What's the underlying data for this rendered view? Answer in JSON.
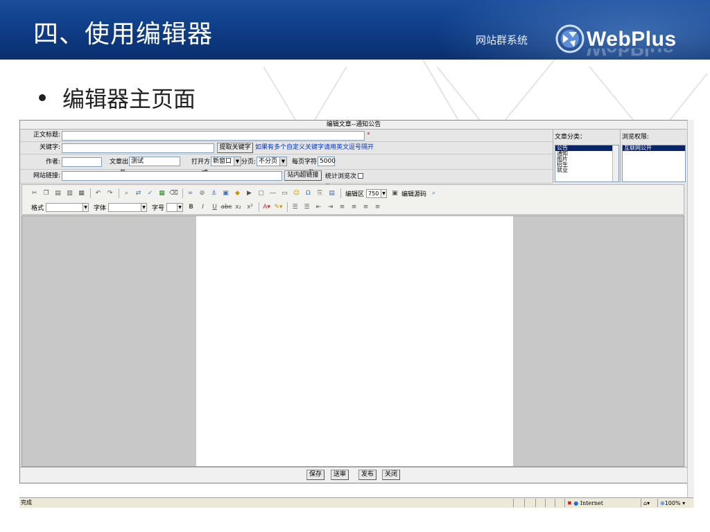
{
  "slide": {
    "title": "四、使用编辑器",
    "brand_sub": "网站群系统",
    "brand_name": "WebPlus",
    "bullet": "编辑器主页面"
  },
  "window": {
    "title": "编辑文章--通知公告"
  },
  "form": {
    "title_label": "正文标题:",
    "required_mark": "*",
    "keyword_label": "关键字:",
    "keyword_button": "提取关键字",
    "keyword_hint": "如果有多个自定义关键字请用英文逗号隔开",
    "author_label": "作者:",
    "source_label": "文章出处:",
    "source_value": "测试",
    "open_mode_label": "打开方式:",
    "open_mode_value": "新窗口",
    "paging_label": "分页:",
    "paging_value": "不分页",
    "chars_label": "每页字符数:",
    "chars_value": "5000",
    "link_label": "网站链接:",
    "site_link_button": "站内超链接",
    "count_label": "统计浏览次数"
  },
  "category": {
    "label": "文章分类：",
    "items": [
      "公告",
      "通知",
      "图片",
      "招生",
      "就业"
    ],
    "selected": "公告"
  },
  "permission": {
    "label": "浏览权限:",
    "items": [
      "互联网公开"
    ]
  },
  "toolbar": {
    "edit_area_label": "编辑区",
    "edit_area_value": "750",
    "source_code_label": "编辑源码",
    "format_label": "格式",
    "font_label": "字体",
    "size_label": "字号"
  },
  "actions": {
    "save": "保存",
    "submit": "送审",
    "publish": "发布",
    "close": "关闭"
  },
  "status": {
    "text": "完成",
    "zone": "Internet",
    "zoom": "100%"
  }
}
